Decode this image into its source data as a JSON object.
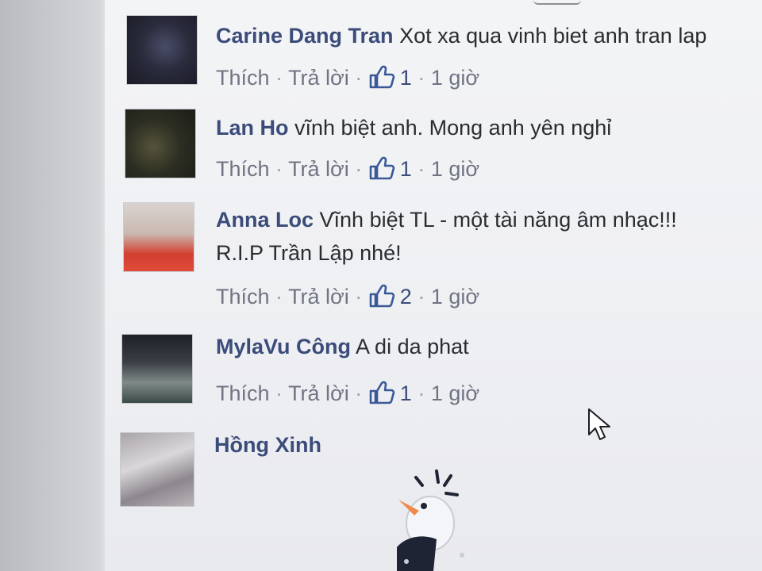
{
  "comments": [
    {
      "author": "Carine Dang Tran",
      "text": "Xot xa qua vinh biet anh tran lap",
      "text2": "",
      "like_label": "Thích",
      "reply_label": "Trả lời",
      "likes": "1",
      "time": "1 giờ"
    },
    {
      "author": "Lan Ho",
      "text": "vĩnh biệt anh. Mong anh yên nghỉ",
      "text2": "",
      "like_label": "Thích",
      "reply_label": "Trả lời",
      "likes": "1",
      "time": "1 giờ"
    },
    {
      "author": "Anna Loc",
      "text": "Vĩnh biệt TL - một tài năng âm nhạc!!!",
      "text2": "R.I.P Trần Lập nhé!",
      "like_label": "Thích",
      "reply_label": "Trả lời",
      "likes": "2",
      "time": "1 giờ"
    },
    {
      "author": "MylaVu Công",
      "text": "A di da phat",
      "text2": "",
      "like_label": "Thích",
      "reply_label": "Trả lời",
      "likes": "1",
      "time": "1 giờ"
    },
    {
      "author": "Hồng Xinh",
      "text": "",
      "text2": ""
    }
  ],
  "separator": "·",
  "icons": {
    "like": "thumbs-up-icon",
    "cursor": "mouse-pointer-icon",
    "sticker": "bird-sticker"
  },
  "colors": {
    "author": "#3b4c7a",
    "body_text": "#2b2c30",
    "action_text": "#6f7483",
    "like_icon": "#3b5998"
  }
}
